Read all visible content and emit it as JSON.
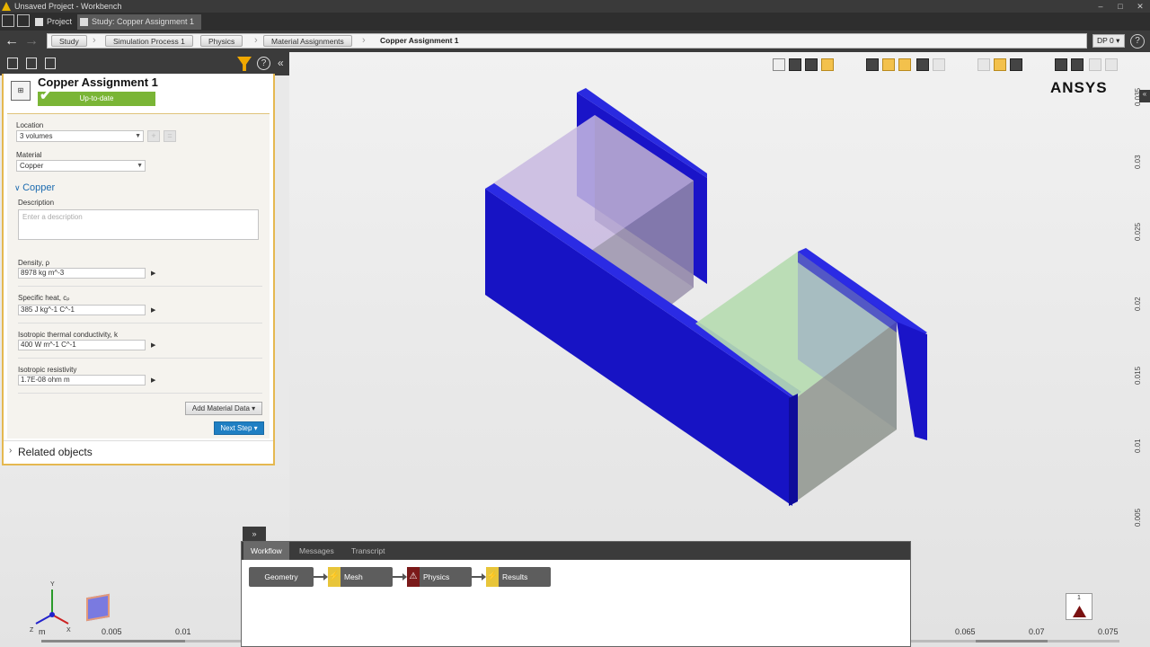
{
  "window": {
    "title": "Unsaved Project - Workbench",
    "controls": [
      "–",
      "□",
      "✕"
    ]
  },
  "tabs": [
    {
      "label": "Project"
    },
    {
      "label": "Study: Copper Assignment 1"
    }
  ],
  "breadcrumb": {
    "items": [
      "Study",
      "Simulation Process 1",
      "Physics",
      "Material Assignments"
    ],
    "current": "Copper Assignment 1",
    "dp_selector": "DP 0 ▾",
    "help": "?"
  },
  "panel": {
    "title": "Copper Assignment 1",
    "status": "Up-to-date",
    "location_label": "Location",
    "location_value": "3 volumes",
    "material_label": "Material",
    "material_value": "Copper",
    "section_title": "Copper",
    "description_label": "Description",
    "description_placeholder": "Enter a description",
    "properties": [
      {
        "label": "Density, ρ",
        "value": "8978 kg m^-3"
      },
      {
        "label": "Specific heat, cₚ",
        "value": "385 J kg^-1 C^-1"
      },
      {
        "label": "Isotropic thermal conductivity, k",
        "value": "400 W m^-1 C^-1"
      },
      {
        "label": "Isotropic resistivity",
        "value": "1.7E-08 ohm m"
      }
    ],
    "add_material_button": "Add Material Data ▾",
    "next_step_button": "Next Step ▾",
    "related_objects": "Related objects"
  },
  "viewport": {
    "logo": "ANSYS",
    "ruler_right": [
      "0.035",
      "0.03",
      "0.025",
      "0.02",
      "0.015",
      "0.01",
      "0.005"
    ],
    "ruler_bottom": [
      "m",
      "0.005",
      "0.01",
      "0.065",
      "0.07",
      "0.075"
    ],
    "warning_count": "1",
    "colors": {
      "body": "#1a14c8",
      "copper_volume": "#c8b8e0",
      "green_volume": "#b6dbb0"
    }
  },
  "workflow": {
    "toggle": "»",
    "tabs": [
      "Workflow",
      "Messages",
      "Transcript"
    ],
    "nodes": [
      {
        "label": "Geometry",
        "badge": ""
      },
      {
        "label": "Mesh",
        "badge": "⚡"
      },
      {
        "label": "Physics",
        "badge": "⚠"
      },
      {
        "label": "Results",
        "badge": "⚡"
      }
    ]
  }
}
